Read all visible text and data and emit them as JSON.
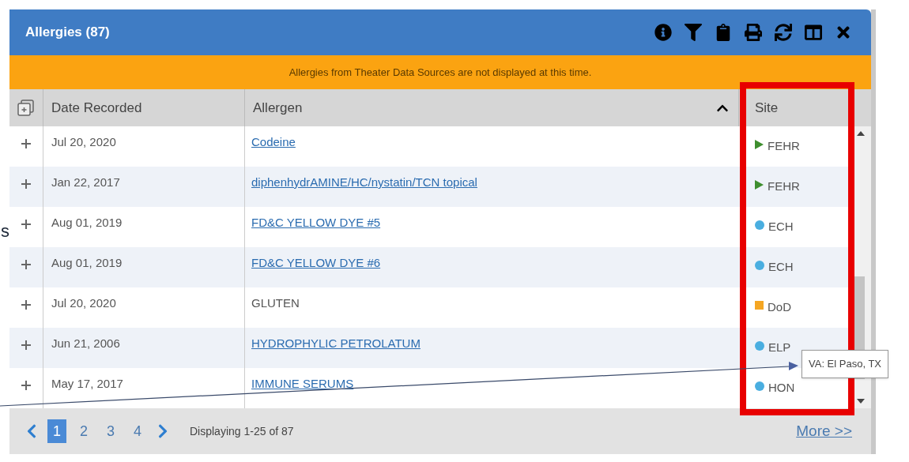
{
  "panel": {
    "title": "Allergies (87)"
  },
  "banner": "Allergies from Theater Data Sources are not displayed at this time.",
  "columns": [
    {
      "label": "Date Recorded"
    },
    {
      "label": "Allergen",
      "sorted": true
    },
    {
      "label": "Site"
    }
  ],
  "rows": [
    {
      "date": "Jul 20, 2020",
      "allergen": "Codeine",
      "link": true,
      "site": "FEHR",
      "marker": {
        "kind": "triangle",
        "color": "#3e8e2e"
      }
    },
    {
      "date": "Jan 22, 2017",
      "allergen": "diphenhydrAMINE/HC/nystatin/TCN topical",
      "link": true,
      "site": "FEHR",
      "marker": {
        "kind": "triangle",
        "color": "#3e8e2e"
      }
    },
    {
      "date": "Aug 01, 2019",
      "allergen": "FD&C YELLOW DYE #5",
      "link": true,
      "site": "ECH",
      "marker": {
        "kind": "circle",
        "color": "#4aaee0"
      }
    },
    {
      "date": "Aug 01, 2019",
      "allergen": "FD&C YELLOW DYE #6",
      "link": true,
      "site": "ECH",
      "marker": {
        "kind": "circle",
        "color": "#4aaee0"
      }
    },
    {
      "date": "Jul 20, 2020",
      "allergen": "GLUTEN",
      "link": false,
      "site": "DoD",
      "marker": {
        "kind": "square",
        "color": "#f5a623"
      }
    },
    {
      "date": "Jun 21, 2006",
      "allergen": "HYDROPHYLIC PETROLATUM",
      "link": true,
      "site": "ELP",
      "marker": {
        "kind": "circle",
        "color": "#4aaee0"
      }
    },
    {
      "date": "May 17, 2017",
      "allergen": "IMMUNE SERUMS",
      "link": true,
      "site": "HON",
      "marker": {
        "kind": "circle",
        "color": "#4aaee0"
      }
    }
  ],
  "pagination": {
    "pages": [
      {
        "label": "1",
        "selected": true
      },
      {
        "label": "2",
        "selected": false
      },
      {
        "label": "3",
        "selected": false
      },
      {
        "label": "4",
        "selected": false
      }
    ],
    "summary": "Displaying 1-25 of 87",
    "more": "More >>"
  },
  "tooltip": "VA: El Paso, TX",
  "annotation_fragment": "s"
}
